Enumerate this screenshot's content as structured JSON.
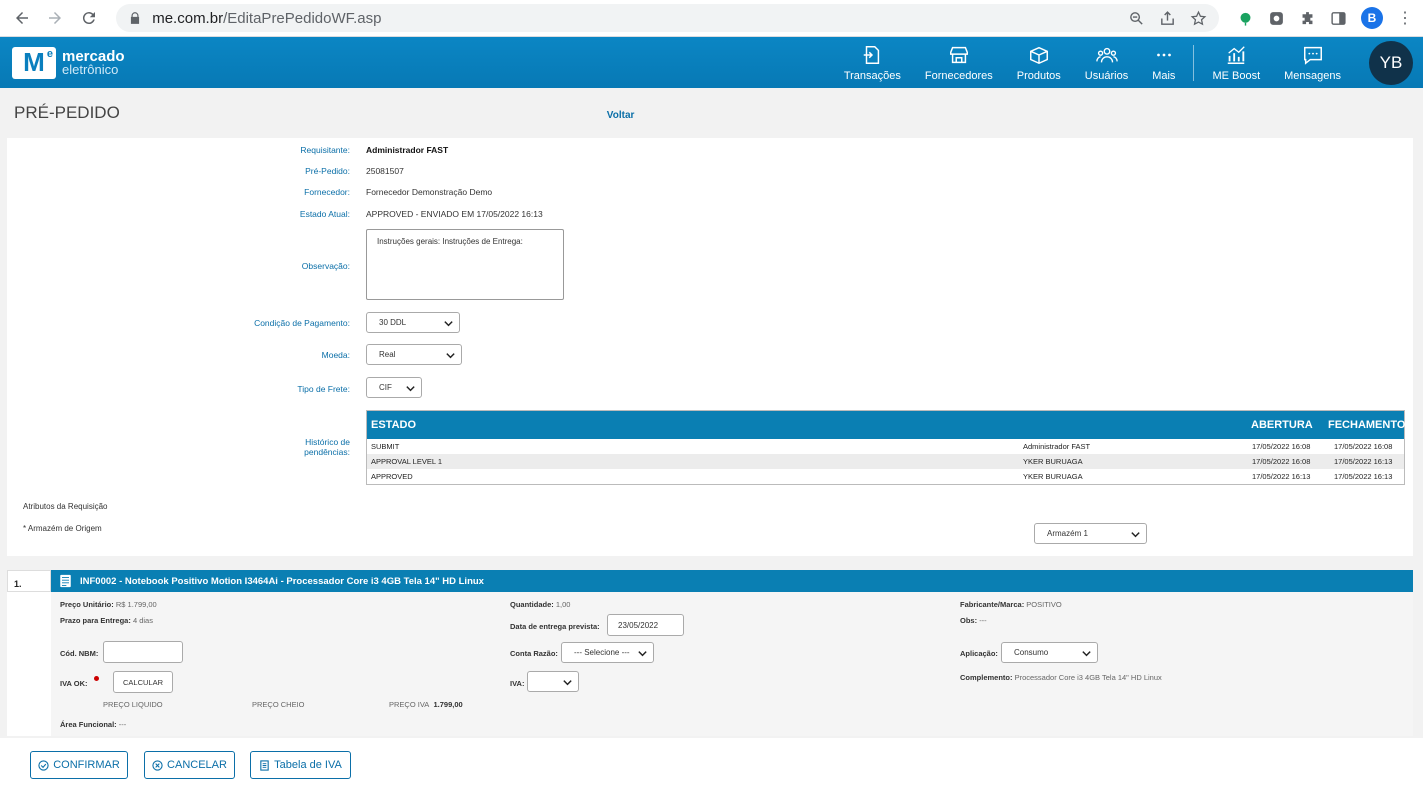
{
  "browser": {
    "url_host": "me.com.br",
    "url_path": "/EditaPrePedidoWF.asp",
    "profile_initial": "B"
  },
  "app": {
    "logo_line1": "mercado",
    "logo_line2": "eletrônico",
    "logo_letter": "M",
    "logo_sup": "e",
    "nav": [
      {
        "label": "Transações",
        "icon": "transactions-icon"
      },
      {
        "label": "Fornecedores",
        "icon": "store-icon"
      },
      {
        "label": "Produtos",
        "icon": "box-icon"
      },
      {
        "label": "Usuários",
        "icon": "users-icon"
      },
      {
        "label": "Mais",
        "icon": "more-icon"
      },
      {
        "label": "ME Boost",
        "icon": "chart-icon"
      },
      {
        "label": "Mensagens",
        "icon": "message-icon"
      }
    ],
    "avatar": "YB"
  },
  "page": {
    "title": "PRÉ-PEDIDO",
    "back_link": "Voltar"
  },
  "form": {
    "requisitante_label": "Requisitante:",
    "requisitante": "Administrador FAST",
    "pre_pedido_label": "Pré-Pedido:",
    "pre_pedido": "25081507",
    "fornecedor_label": "Fornecedor:",
    "fornecedor": "Fornecedor Demonstração Demo",
    "estado_label": "Estado Atual:",
    "estado": "APPROVED - ENVIADO EM 17/05/2022 16:13",
    "observacao_label": "Observação:",
    "observacao": "Instruções gerais:    Instruções de Entrega:",
    "pagamento_label": "Condição de Pagamento:",
    "pagamento": "30 DDL",
    "moeda_label": "Moeda:",
    "moeda": "Real",
    "frete_label": "Tipo de Frete:",
    "frete": "CIF",
    "historico_label_1": "Histórico de",
    "historico_label_2": "pendências:",
    "atributos_title": "Atributos da Requisição",
    "armazem_label": "* Armazém de Origem",
    "armazem": "Armazém 1"
  },
  "history": {
    "headers": [
      "ESTADO",
      "",
      "ABERTURA",
      "FECHAMENTO"
    ],
    "rows": [
      {
        "estado": "SUBMIT",
        "usuario": "Administrador FAST",
        "abertura": "17/05/2022 16:08",
        "fechamento": "17/05/2022 16:08"
      },
      {
        "estado": "APPROVAL LEVEL 1",
        "usuario": "YKER BURUAGA",
        "abertura": "17/05/2022 16:08",
        "fechamento": "17/05/2022 16:13"
      },
      {
        "estado": "APPROVED",
        "usuario": "YKER BURUAGA",
        "abertura": "17/05/2022 16:13",
        "fechamento": "17/05/2022 16:13"
      }
    ]
  },
  "item": {
    "number": "1.",
    "title": "INF0002 - Notebook Positivo Motion I3464Ai - Processador Core i3 4GB Tela 14\" HD Linux",
    "preco_unitario_label": "Preço Unitário:",
    "preco_unitario": "R$  1.799,00",
    "prazo_label": "Prazo para Entrega:",
    "prazo": "4 dias",
    "quantidade_label": "Quantidade:",
    "quantidade": "1,00",
    "data_entrega_label": "Data de entrega prevista:",
    "data_entrega": "23/05/2022",
    "fabricante_label": "Fabricante/Marca:",
    "fabricante": "POSITIVO",
    "obs_label": "Obs:",
    "obs": "---",
    "nbm_label": "Cód. NBM:",
    "nbm": "",
    "conta_label": "Conta Razão:",
    "conta": "--- Selecione ---",
    "aplicacao_label": "Aplicação:",
    "aplicacao": "Consumo",
    "iva_ok_label": "IVA OK:",
    "calcular": "CALCULAR",
    "iva_label": "IVA:",
    "iva": "",
    "complemento_label": "Complemento:",
    "complemento": "Processador Core i3 4GB Tela 14\" HD Linux",
    "preco_liquido": "PREÇO LIQUIDO",
    "preco_cheio": "PREÇO CHEIO",
    "preco_iva_label": "PREÇO IVA",
    "preco_iva": "1.799,00",
    "area_label": "Área Funcional:",
    "area": "---"
  },
  "footer": {
    "confirmar": "CONFIRMAR",
    "cancelar": "CANCELAR",
    "tabela_iva": "Tabela de IVA"
  },
  "colors": {
    "brand": "#0a7fb3",
    "link": "#0b6fa8",
    "alert": "#cc0000"
  }
}
